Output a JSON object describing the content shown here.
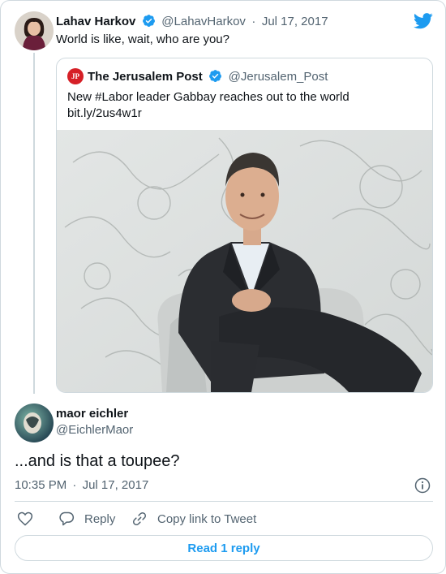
{
  "parent_tweet": {
    "author_name": "Lahav Harkov",
    "handle": "@LahavHarkov",
    "separator": "·",
    "date": "Jul 17, 2017",
    "text": "World is like, wait, who are you?"
  },
  "quoted_tweet": {
    "author_name": "The Jerusalem Post",
    "handle": "@Jerusalem_Post",
    "text_line1": "New #Labor leader Gabbay reaches out to the world",
    "text_line2": "bit.ly/2us4w1r",
    "logo_text": "JP"
  },
  "reply_tweet": {
    "author_name": "maor eichler",
    "handle": "@EichlerMaor",
    "text": "...and is that a toupee?",
    "time": "10:35 PM",
    "separator": "·",
    "date": "Jul 17, 2017"
  },
  "actions": {
    "reply_label": "Reply",
    "copy_link_label": "Copy link to Tweet",
    "read_replies_label": "Read 1 reply"
  },
  "colors": {
    "twitter_blue": "#1d9bf0",
    "muted": "#536471",
    "border": "#cfd9de",
    "jpost_red": "#d62027"
  },
  "icons": [
    "twitter-bird-icon",
    "verified-badge-icon",
    "info-icon",
    "heart-icon",
    "reply-icon",
    "link-icon"
  ]
}
